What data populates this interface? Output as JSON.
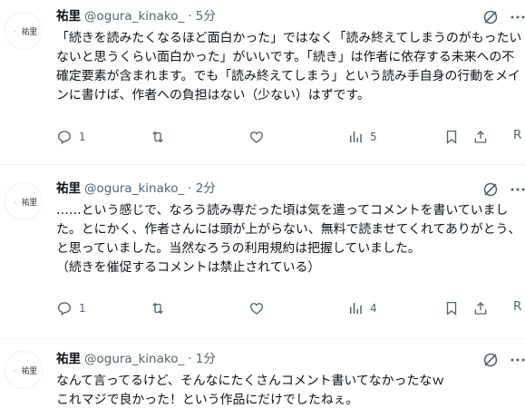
{
  "tweets": [
    {
      "avatar_text": "祐里",
      "name": "祐里",
      "handle": "@ogura_kinako_",
      "time": "· 5分",
      "text": "「続きを読みたくなるほど面白かった」ではなく「読み終えてしまうのがもったいないと思うくらい面白かった」がいいです。「続き」は作者に依存する未来への不確定要素が含まれます。でも「読み終えてしまう」という読み手自身の行動をメインに書けば、作者への負担はない（少ない）はずです。",
      "reply_count": "1",
      "views": "5",
      "partial_label": "R"
    },
    {
      "avatar_text": "祐里",
      "name": "祐里",
      "handle": "@ogura_kinako_",
      "time": "· 2分",
      "text": "……という感じで、なろう読み専だった頃は気を遣ってコメントを書いていました。とにかく、作者さんには頭が上がらない、無料で読ませてくれてありがとう、と思っていました。当然なろうの利用規約は把握していました。\n（続きを催促するコメントは禁止されている）",
      "reply_count": "1",
      "views": "4",
      "partial_label": "R"
    },
    {
      "avatar_text": "祐里",
      "name": "祐里",
      "handle": "@ogura_kinako_",
      "time": "· 1分",
      "text": "なんて言ってるけど、そんなにたくさんコメント書いてなかったなｗ\nこれマジで良かった！という作品にだけでしたねぇ。"
    }
  ],
  "icons": [
    "grok-icon",
    "more-icon",
    "reply-icon",
    "retweet-icon",
    "like-icon",
    "views-icon",
    "bookmark-icon",
    "share-icon"
  ],
  "colors": {
    "text": "#0f1419",
    "secondary": "#536471",
    "divider": "#eff3f4"
  }
}
